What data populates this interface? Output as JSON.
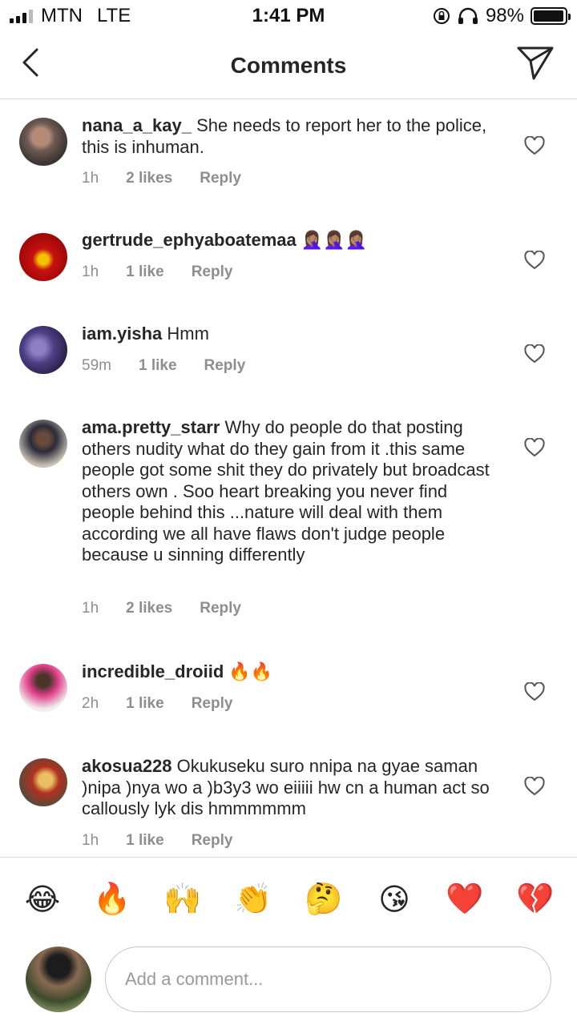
{
  "status_bar": {
    "carrier": "MTN",
    "network": "LTE",
    "time": "1:41 PM",
    "battery_percent": "98%",
    "battery_level": 0.98
  },
  "header": {
    "title": "Comments",
    "back_icon": "chevron-left-icon",
    "send_icon": "paper-plane-icon"
  },
  "comments": [
    {
      "username": "nana_a_kay_",
      "text": " She needs to report her to the police, this is inhuman.",
      "time": "1h",
      "likes": "2 likes",
      "reply": "Reply"
    },
    {
      "username": "gertrude_ephyaboatemaa",
      "text": " 🤦🏽‍♀️🤦🏽‍♀️🤦🏽‍♀️",
      "time": "1h",
      "likes": "1 like",
      "reply": "Reply"
    },
    {
      "username": "iam.yisha",
      "text": " Hmm",
      "time": "59m",
      "likes": "1 like",
      "reply": "Reply"
    },
    {
      "username": "ama.pretty_starr",
      "text": " Why do people do that posting others nudity what do they gain from it .this same people got some shit they do privately but broadcast others own . Soo heart breaking you never find people behind this ...nature will deal with them according we all have flaws don't judge people because u sinning differently",
      "time": "1h",
      "likes": "2 likes",
      "reply": "Reply"
    },
    {
      "username": "incredible_droiid",
      "text": " 🔥🔥",
      "time": "2h",
      "likes": "1 like",
      "reply": "Reply"
    },
    {
      "username": "akosua228",
      "text": " Okukuseku suro nnipa na gyae saman )nipa )nya wo a )b3y3 wo eiiiii hw cn a human act so callously lyk dis hmmmmmm",
      "time": "1h",
      "likes": "1 like",
      "reply": "Reply"
    }
  ],
  "emoji_bar": [
    "😂",
    "🔥",
    "🙌",
    "👏",
    "🤔",
    "😘",
    "❤️",
    "💔"
  ],
  "composer": {
    "placeholder": "Add a comment..."
  },
  "colors": {
    "text": "#262626",
    "muted": "#8e8e8e",
    "divider": "#dbdbdb"
  }
}
